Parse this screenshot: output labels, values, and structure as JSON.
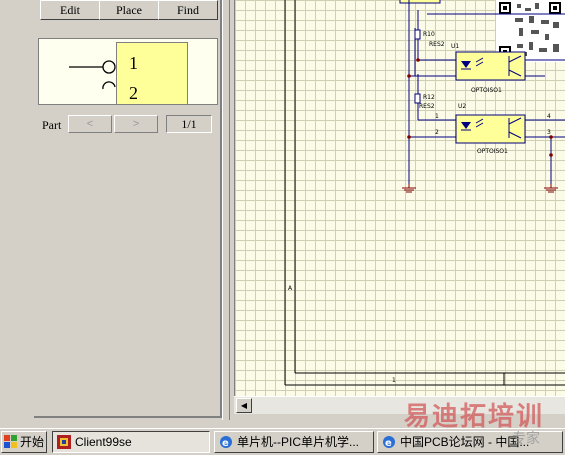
{
  "library_panel": {
    "buttons": {
      "edit": "Edit",
      "place": "Place",
      "find": "Find"
    },
    "preview": {
      "pin1": "1",
      "pin2": "2"
    },
    "part": {
      "label": "Part",
      "prev": "<",
      "next": ">",
      "count": "1/1"
    }
  },
  "schematic": {
    "r1": {
      "ref": "R10",
      "value": "RES2"
    },
    "u1": {
      "ref": "U1",
      "part": "OPTOISO1"
    },
    "r2": {
      "ref": "R12",
      "value": "RES2"
    },
    "u2": {
      "ref": "U2",
      "part": "OPTOISO1"
    },
    "pins": {
      "p1": "1",
      "p2": "2",
      "p3": "3",
      "p4": "4"
    },
    "border_marks": {
      "a": "A",
      "one": "1"
    },
    "colors": {
      "grid": "#cfcfb4",
      "background": "#fbfbe8",
      "wire": "#000080",
      "component": "#000080",
      "junction": "#800000",
      "symbol_fill": "#ffff99"
    }
  },
  "watermark": {
    "main": "易迪拓培训",
    "sub": "专家"
  },
  "taskbar": {
    "start": "开始",
    "tasks": [
      "Client99se",
      "单片机--PIC单片机学...",
      "中国PCB论坛网 - 中国..."
    ]
  },
  "icons": [
    "windows-flag-icon",
    "client99se-icon",
    "ie-icon",
    "scroll-left-arrow-icon",
    "qr-code-icon",
    "ground-icon"
  ]
}
